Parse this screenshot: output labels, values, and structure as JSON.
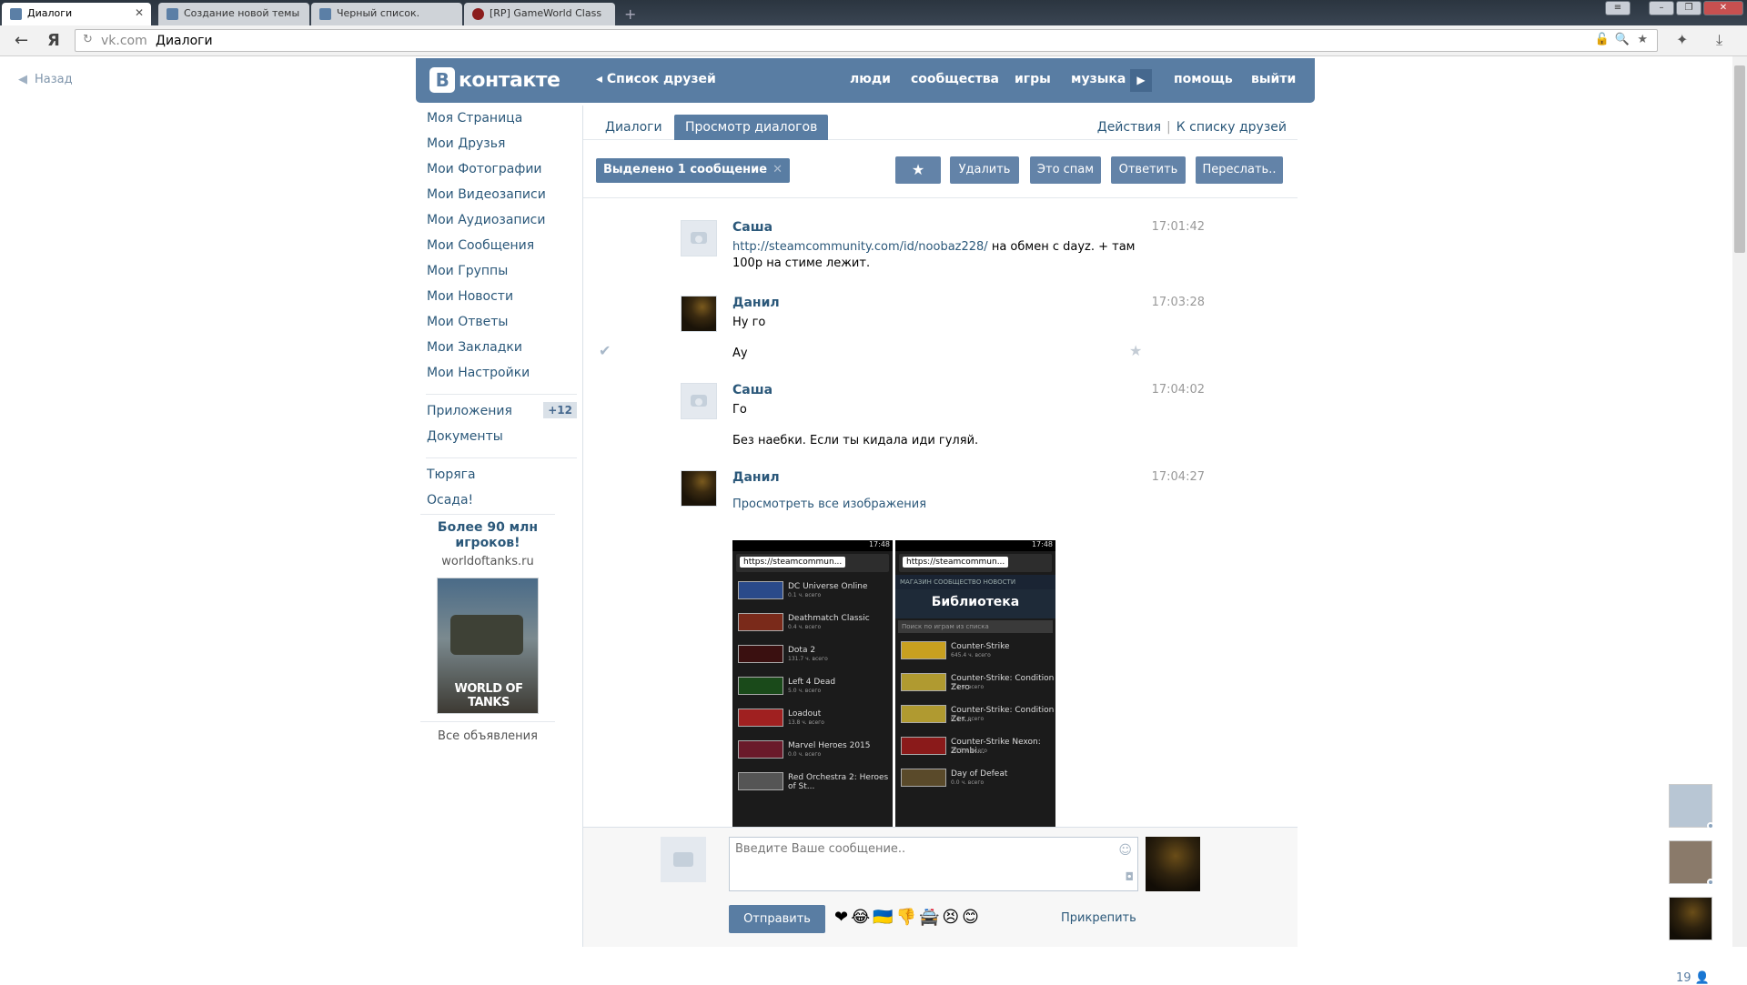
{
  "browser": {
    "tabs": [
      {
        "label": "Диалоги",
        "active": true
      },
      {
        "label": "Создание новой темы",
        "active": false
      },
      {
        "label": "Черный список.",
        "active": false
      },
      {
        "label": "[RP] GameWorld Class",
        "active": false
      }
    ],
    "address": {
      "domain": "vk.com",
      "title": "Диалоги"
    },
    "window_controls": [
      "≡",
      "–",
      "❐",
      "✕"
    ]
  },
  "page": {
    "back_label": "Назад"
  },
  "vk": {
    "logo": "контакте",
    "logo_letter": "В",
    "friends_link": "Список друзей",
    "nav": [
      "люди",
      "сообщества",
      "игры",
      "музыка",
      "помощь",
      "выйти"
    ]
  },
  "left_menu": {
    "items": [
      "Моя Страница",
      "Мои Друзья",
      "Мои Фотографии",
      "Мои Видеозаписи",
      "Мои Аудиозаписи",
      "Мои Сообщения",
      "Мои Группы",
      "Мои Новости",
      "Мои Ответы",
      "Мои Закладки",
      "Мои Настройки"
    ],
    "apps_label": "Приложения",
    "apps_badge": "+12",
    "docs_label": "Документы",
    "extra": [
      "Тюряга",
      "Осада!"
    ]
  },
  "ad": {
    "title": "Более 90 млн игроков!",
    "domain": "worldoftanks.ru",
    "logo_text": "WORLD OF TANKS",
    "all_ads": "Все объявления"
  },
  "main": {
    "tabs": [
      "Диалоги",
      "Просмотр диалогов"
    ],
    "actions": [
      "Действия",
      "К списку друзей"
    ],
    "selection": "Выделено 1 сообщение",
    "buttons": [
      "★",
      "Удалить",
      "Это спам",
      "Ответить",
      "Переслать.."
    ]
  },
  "messages": [
    {
      "author": "Саша",
      "time": "17:01:42",
      "link": "http://steamcommunity.com/id/noobaz228/",
      "text": "на обмен с dayz. + там 100р на стиме лежит."
    },
    {
      "author": "Данил",
      "time": "17:03:28",
      "text": "Ну го",
      "text2": "Ау"
    },
    {
      "author": "Саша",
      "time": "17:04:02",
      "text": "Го",
      "text2": "Без наебки. Если ты кидала иди гуляй."
    },
    {
      "author": "Данил",
      "time": "17:04:27",
      "view_all": "Просмотреть все изображения"
    }
  ],
  "screens": {
    "status_time": "17:48",
    "url": "https://steamcommun...",
    "games_left": [
      {
        "name": "DC Universe Online",
        "sub": "0.1 ч. всего"
      },
      {
        "name": "Deathmatch Classic",
        "sub": "0.4 ч. всего"
      },
      {
        "name": "Dota 2",
        "sub": "131.7 ч. всего"
      },
      {
        "name": "Left 4 Dead",
        "sub": "5.0 ч. всего"
      },
      {
        "name": "Loadout",
        "sub": "13.8 ч. всего"
      },
      {
        "name": "Marvel Heroes 2015",
        "sub": "0.0 ч. всего"
      },
      {
        "name": "Red Orchestra 2: Heroes of St...",
        "sub": ""
      }
    ],
    "tabs_right": "МАГАЗИН  СООБЩЕСТВО  НОВОСТИ",
    "library_title": "Библиотека",
    "library_search": "Поиск по играм из списка",
    "games_right": [
      {
        "name": "Counter-Strike",
        "sub": "645.4 ч. всего"
      },
      {
        "name": "Counter-Strike: Condition Zero",
        "sub": "7.4 ч. всего"
      },
      {
        "name": "Counter-Strike: Condition Zer...",
        "sub": "0.4 ч. всего"
      },
      {
        "name": "Counter-Strike Nexon: Zombi...",
        "sub": "20.6 ч. всего"
      },
      {
        "name": "Day of Defeat",
        "sub": "0.0 ч. всего"
      }
    ]
  },
  "composer": {
    "placeholder": "Введите Ваше сообщение..",
    "send": "Отправить",
    "emoji": "❤😂🇺🇦👎🚔😣😊",
    "attach": "Прикрепить"
  },
  "right_panel": {
    "count": "19"
  }
}
